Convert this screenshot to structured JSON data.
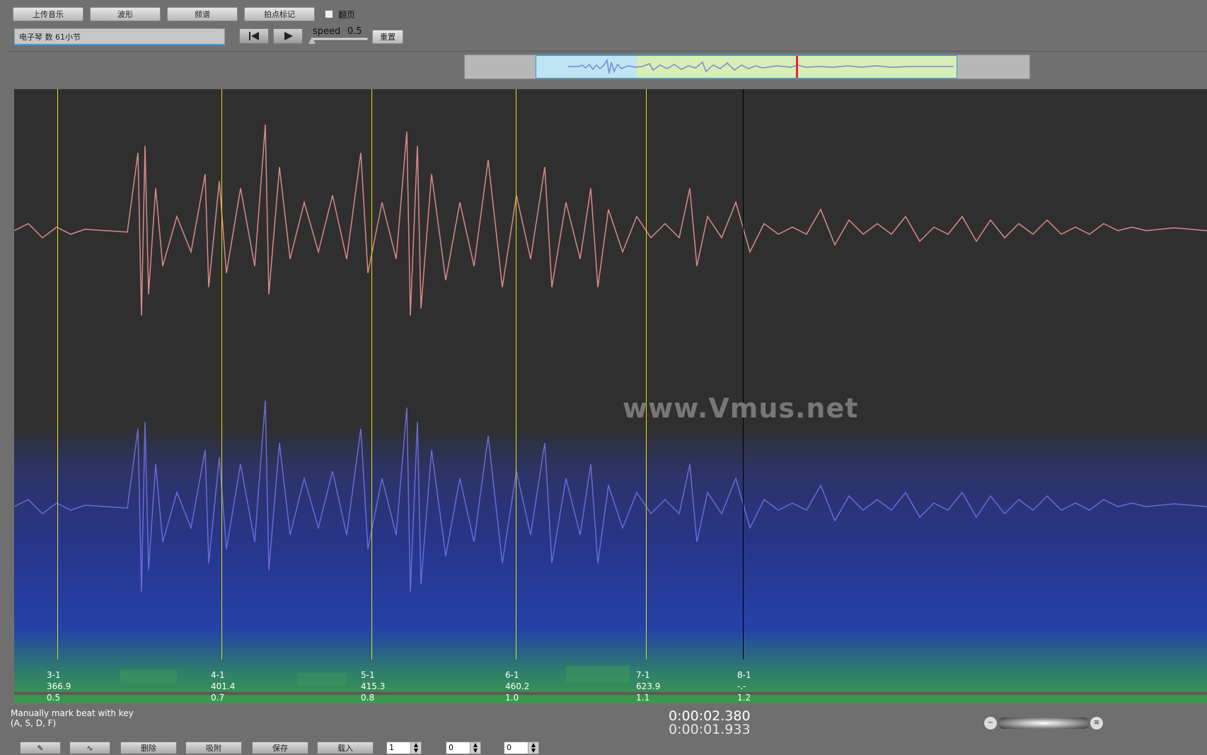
{
  "toolbar": {
    "upload_label": "上传音乐",
    "waveform_label": "波形",
    "spectrum_label": "频谱",
    "beat_mark_label": "拍点标记",
    "flip_label": "翻页",
    "song_title": "电子琴 数 61小节",
    "speed_label": "speed",
    "speed_value": "0.5",
    "reset_label": "重置"
  },
  "beats": [
    {
      "id": "3-1",
      "value": "366.9",
      "ratio": "0.5"
    },
    {
      "id": "4-1",
      "value": "401.4",
      "ratio": "0.7"
    },
    {
      "id": "5-1",
      "value": "415.3",
      "ratio": "0.8"
    },
    {
      "id": "6-1",
      "value": "460.2",
      "ratio": "1.0"
    },
    {
      "id": "7-1",
      "value": "623.9",
      "ratio": "1.1"
    },
    {
      "id": "8-1",
      "value": "-.-",
      "ratio": "1.2"
    }
  ],
  "watermark": "www.Vmus.net",
  "status": {
    "line1": "Manually mark beat with key",
    "line2": "(A, S, D, F)"
  },
  "time": {
    "current": "0:00:02.380",
    "total": "0:00:01.933"
  },
  "bottom": {
    "delete_label": "删除",
    "snap_label": "吸附",
    "save_label": "保存",
    "load_label": "载入",
    "spin1": "1",
    "spin2": "0",
    "spin3": "0"
  }
}
